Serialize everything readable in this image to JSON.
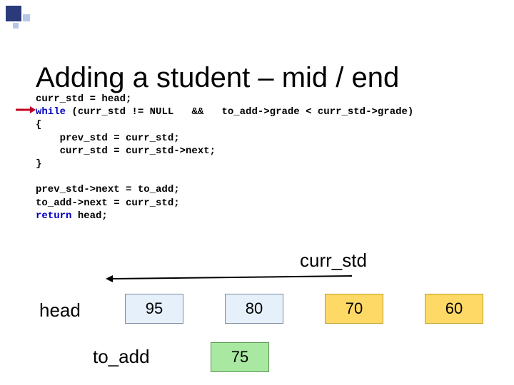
{
  "title": "Adding a student – mid / end",
  "code": {
    "l1": "curr_std = head;",
    "kw_while": "while",
    "l2_rest": " (curr_std != NULL   &&   to_add->grade < curr_std->grade)",
    "l3": "{",
    "l4": "    prev_std = curr_std;",
    "l5": "    curr_std = curr_std->next;",
    "l6": "}",
    "blank": "",
    "l8": "prev_std->next = to_add;",
    "l9": "to_add->next = curr_std;",
    "kw_return": "return",
    "l10_rest": " head;"
  },
  "labels": {
    "curr_std": "curr_std",
    "head": "head",
    "to_add": "to_add"
  },
  "nodes": {
    "n95": "95",
    "n80": "80",
    "n70": "70",
    "n60": "60",
    "n75": "75"
  }
}
